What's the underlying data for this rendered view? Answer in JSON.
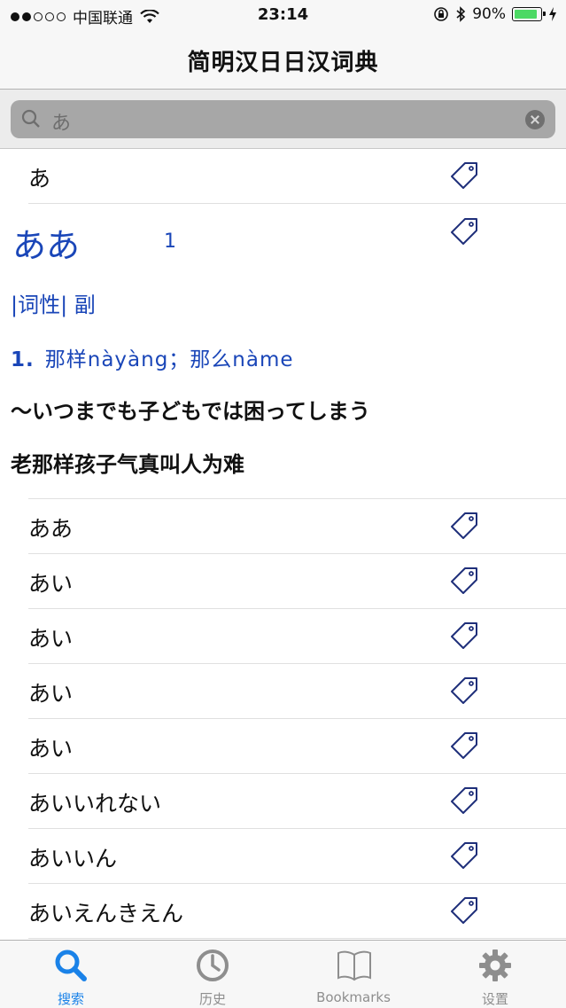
{
  "status_bar": {
    "carrier": "中国联通",
    "time": "23:14",
    "battery": "90%",
    "battery_level": 0.9
  },
  "nav": {
    "title": "简明汉日日汉词典"
  },
  "search": {
    "query": "あ"
  },
  "results_top": [
    {
      "label": "あ"
    }
  ],
  "detail": {
    "headword": "ああ",
    "number": "1",
    "pos": "|词性|  副",
    "sense_number": "1.",
    "sense_text": "那样nàyàng；那么nàme",
    "example_jp": "～いつまでも子どもでは困ってしまう",
    "example_cn": "老那样孩子气真叫人为难"
  },
  "results": [
    {
      "label": "ああ"
    },
    {
      "label": "あい"
    },
    {
      "label": "あい"
    },
    {
      "label": "あい"
    },
    {
      "label": "あい"
    },
    {
      "label": "あいいれない"
    },
    {
      "label": "あいいん"
    },
    {
      "label": "あいえんきえん"
    }
  ],
  "tabs": [
    {
      "label": "搜索",
      "icon": "search-icon",
      "active": true
    },
    {
      "label": "历史",
      "icon": "clock-icon",
      "active": false
    },
    {
      "label": "Bookmarks",
      "icon": "book-icon",
      "active": false
    },
    {
      "label": "设置",
      "icon": "gear-icon",
      "active": false
    }
  ],
  "colors": {
    "accent": "#1a82e8",
    "entry_blue": "#1a46b8",
    "tag_outline": "#1f2f7a",
    "battery_green": "#4cd964"
  }
}
